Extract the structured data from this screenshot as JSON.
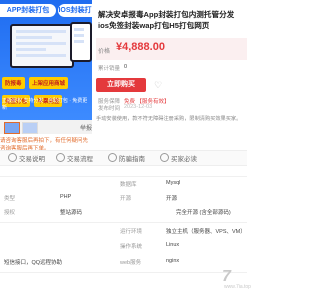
{
  "product": {
    "title": "解决安卓报毒App封装打包内测托管分发ios免签封装wap打包H5打包网页",
    "price_label": "价格",
    "price": "¥4,888.00",
    "rows": [
      {
        "label": "累计销量",
        "value": "0"
      },
      {
        "label": "服务保障",
        "value": "免费 【服务有效】"
      },
      {
        "label": "发布时间",
        "value": "2023-12-03"
      }
    ],
    "buy_label": "立即购买",
    "description": "手动安装使用，款不符无障碍注册采购，限制清购买效果买家。"
  },
  "banner": {
    "tag_left": "APP封装打包",
    "tag_right": "IOS封装打包",
    "badges": [
      "防报毒",
      "上架应用商城",
      "免签打包",
      "苹果免签"
    ],
    "features": "正版授权 支持分发 · 自助打包 · 免费更新"
  },
  "gallery": {
    "favorite_label": "举报",
    "notice": "请咨询客服后再拍下，有任何疑问先咨询客服后再下单。"
  },
  "tabs": [
    {
      "label": "交易说明",
      "icon": "info-icon"
    },
    {
      "label": "交易流程",
      "icon": "flow-icon"
    },
    {
      "label": "防骗指南",
      "icon": "shield-icon"
    },
    {
      "label": "买家必读",
      "icon": "book-icon"
    }
  ],
  "specs": [
    {
      "k": "",
      "v": "",
      "k2": "数据库",
      "v2": "Mysql",
      "k3": "",
      "v3": ""
    },
    {
      "k": "类型",
      "v": "PHP",
      "k2": "开源",
      "v2": "开源",
      "k3": "",
      "v3": ""
    },
    {
      "k": "授权",
      "v": "整站源码",
      "k2": "",
      "v2": "",
      "k3": "",
      "v3": "完全开源 (含全部源码)"
    },
    {
      "k": "",
      "v": "",
      "k2": "运行环境",
      "v2": "独立主机（服务器、VPS、VM）",
      "k3": "",
      "v3": ""
    },
    {
      "k": "",
      "v": "",
      "k2": "操作系统",
      "v2": "Linux",
      "k3": "",
      "v3": ""
    },
    {
      "k": "",
      "v": "短信接口，QQ远程协助",
      "k2": "web服务",
      "v2": "nginx",
      "k3": "",
      "v3": ""
    }
  ],
  "watermark": {
    "text": "7",
    "sub": "www.7ia.top"
  }
}
